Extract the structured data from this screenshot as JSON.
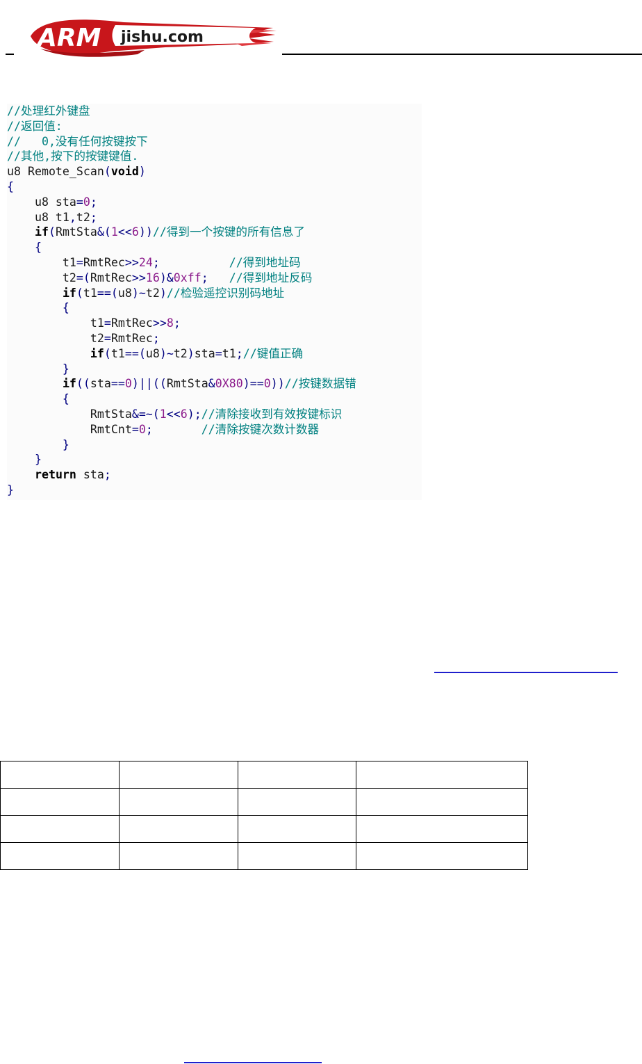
{
  "header": {
    "logo_text": "ARM jishu.com",
    "logo_colors": {
      "red": "#c8161b",
      "white": "#ffffff"
    }
  },
  "code": {
    "lines": [
      [
        {
          "t": "//处理红外键盘",
          "k": "c"
        }
      ],
      [
        {
          "t": "//返回值:",
          "k": "c"
        }
      ],
      [
        {
          "t": "//   0,没有任何按键按下",
          "k": "c"
        }
      ],
      [
        {
          "t": "//其他,按下的按键键值.",
          "k": "c"
        }
      ],
      [
        {
          "t": "u8 Remote_Scan",
          "k": "p"
        },
        {
          "t": "(",
          "k": "op"
        },
        {
          "t": "void",
          "k": "kw"
        },
        {
          "t": ")",
          "k": "op"
        }
      ],
      [
        {
          "t": "{",
          "k": "op"
        }
      ],
      [
        {
          "t": "    u8 sta",
          "k": "p"
        },
        {
          "t": "=",
          "k": "op"
        },
        {
          "t": "0",
          "k": "n"
        },
        {
          "t": ";",
          "k": "op"
        }
      ],
      [
        {
          "t": "    u8 t1",
          "k": "p"
        },
        {
          "t": ",",
          "k": "op"
        },
        {
          "t": "t2",
          "k": "p"
        },
        {
          "t": ";",
          "k": "op"
        }
      ],
      [
        {
          "t": "    ",
          "k": "p"
        },
        {
          "t": "if",
          "k": "kw"
        },
        {
          "t": "(",
          "k": "op"
        },
        {
          "t": "RmtSta",
          "k": "p"
        },
        {
          "t": "&(",
          "k": "op"
        },
        {
          "t": "1",
          "k": "n"
        },
        {
          "t": "<<",
          "k": "op"
        },
        {
          "t": "6",
          "k": "n"
        },
        {
          "t": "))",
          "k": "op"
        },
        {
          "t": "//得到一个按键的所有信息了",
          "k": "c"
        }
      ],
      [
        {
          "t": "    {",
          "k": "op"
        }
      ],
      [
        {
          "t": "        t1",
          "k": "p"
        },
        {
          "t": "=",
          "k": "op"
        },
        {
          "t": "RmtRec",
          "k": "p"
        },
        {
          "t": ">>",
          "k": "op"
        },
        {
          "t": "24",
          "k": "n"
        },
        {
          "t": ";",
          "k": "op"
        },
        {
          "t": "          ",
          "k": "p"
        },
        {
          "t": "//得到地址码",
          "k": "c"
        }
      ],
      [
        {
          "t": "        t2",
          "k": "p"
        },
        {
          "t": "=(",
          "k": "op"
        },
        {
          "t": "RmtRec",
          "k": "p"
        },
        {
          "t": ">>",
          "k": "op"
        },
        {
          "t": "16",
          "k": "n"
        },
        {
          "t": ")&",
          "k": "op"
        },
        {
          "t": "0xff",
          "k": "n"
        },
        {
          "t": ";",
          "k": "op"
        },
        {
          "t": "   ",
          "k": "p"
        },
        {
          "t": "//得到地址反码",
          "k": "c"
        }
      ],
      [
        {
          "t": "        ",
          "k": "p"
        },
        {
          "t": "if",
          "k": "kw"
        },
        {
          "t": "(",
          "k": "op"
        },
        {
          "t": "t1",
          "k": "p"
        },
        {
          "t": "==(",
          "k": "op"
        },
        {
          "t": "u8",
          "k": "p"
        },
        {
          "t": ")~",
          "k": "op"
        },
        {
          "t": "t2",
          "k": "p"
        },
        {
          "t": ")",
          "k": "op"
        },
        {
          "t": "//检验遥控识别码地址",
          "k": "c"
        }
      ],
      [
        {
          "t": "        {",
          "k": "op"
        }
      ],
      [
        {
          "t": "            t1",
          "k": "p"
        },
        {
          "t": "=",
          "k": "op"
        },
        {
          "t": "RmtRec",
          "k": "p"
        },
        {
          "t": ">>",
          "k": "op"
        },
        {
          "t": "8",
          "k": "n"
        },
        {
          "t": ";",
          "k": "op"
        }
      ],
      [
        {
          "t": "            t2",
          "k": "p"
        },
        {
          "t": "=",
          "k": "op"
        },
        {
          "t": "RmtRec",
          "k": "p"
        },
        {
          "t": ";",
          "k": "op"
        }
      ],
      [
        {
          "t": "            ",
          "k": "p"
        },
        {
          "t": "if",
          "k": "kw"
        },
        {
          "t": "(",
          "k": "op"
        },
        {
          "t": "t1",
          "k": "p"
        },
        {
          "t": "==(",
          "k": "op"
        },
        {
          "t": "u8",
          "k": "p"
        },
        {
          "t": ")~",
          "k": "op"
        },
        {
          "t": "t2",
          "k": "p"
        },
        {
          "t": ")",
          "k": "op"
        },
        {
          "t": "sta",
          "k": "p"
        },
        {
          "t": "=",
          "k": "op"
        },
        {
          "t": "t1",
          "k": "p"
        },
        {
          "t": ";",
          "k": "op"
        },
        {
          "t": "//键值正确",
          "k": "c"
        }
      ],
      [
        {
          "t": "        }",
          "k": "op"
        }
      ],
      [
        {
          "t": "        ",
          "k": "p"
        },
        {
          "t": "if",
          "k": "kw"
        },
        {
          "t": "((",
          "k": "op"
        },
        {
          "t": "sta",
          "k": "p"
        },
        {
          "t": "==",
          "k": "op"
        },
        {
          "t": "0",
          "k": "n"
        },
        {
          "t": ")||((",
          "k": "op"
        },
        {
          "t": "RmtSta",
          "k": "p"
        },
        {
          "t": "&",
          "k": "op"
        },
        {
          "t": "0X80",
          "k": "n"
        },
        {
          "t": ")==",
          "k": "op"
        },
        {
          "t": "0",
          "k": "n"
        },
        {
          "t": "))",
          "k": "op"
        },
        {
          "t": "//按键数据错",
          "k": "c"
        }
      ],
      [
        {
          "t": "        {",
          "k": "op"
        }
      ],
      [
        {
          "t": "            RmtSta",
          "k": "p"
        },
        {
          "t": "&=~(",
          "k": "op"
        },
        {
          "t": "1",
          "k": "n"
        },
        {
          "t": "<<",
          "k": "op"
        },
        {
          "t": "6",
          "k": "n"
        },
        {
          "t": ");",
          "k": "op"
        },
        {
          "t": "//清除接收到有效按键标识",
          "k": "c"
        }
      ],
      [
        {
          "t": "            RmtCnt",
          "k": "p"
        },
        {
          "t": "=",
          "k": "op"
        },
        {
          "t": "0",
          "k": "n"
        },
        {
          "t": ";",
          "k": "op"
        },
        {
          "t": "       ",
          "k": "p"
        },
        {
          "t": "//清除按键次数计数器",
          "k": "c"
        }
      ],
      [
        {
          "t": "        }",
          "k": "op"
        }
      ],
      [
        {
          "t": "    }",
          "k": "op"
        }
      ],
      [
        {
          "t": "    ",
          "k": "p"
        },
        {
          "t": "return",
          "k": "kw"
        },
        {
          "t": " sta",
          "k": "p"
        },
        {
          "t": ";",
          "k": "op"
        }
      ],
      [
        {
          "t": "}",
          "k": "op"
        }
      ]
    ]
  },
  "table": {
    "rows": [
      [
        "",
        "",
        "",
        ""
      ],
      [
        "",
        "",
        "",
        ""
      ],
      [
        "",
        "",
        "",
        ""
      ],
      [
        "",
        "",
        "",
        ""
      ]
    ]
  }
}
